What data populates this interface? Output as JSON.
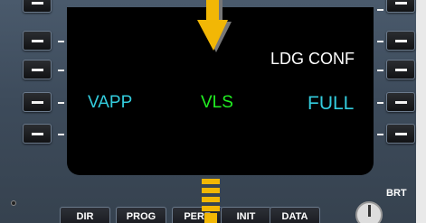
{
  "screen": {
    "left_labels": [
      "VAPP"
    ],
    "center_labels": [
      "VLS"
    ],
    "right_titles": [
      "LDG CONF"
    ],
    "right_values": [
      "FULL"
    ]
  },
  "bottom_buttons": [
    "DIR",
    "PROG",
    "PERF",
    "INIT",
    "DATA"
  ],
  "brightness_label": "BRT",
  "colors": {
    "cyan": "#33ccdd",
    "green": "#22ee22",
    "white": "#ffffff",
    "arrow": "#f2b705"
  }
}
